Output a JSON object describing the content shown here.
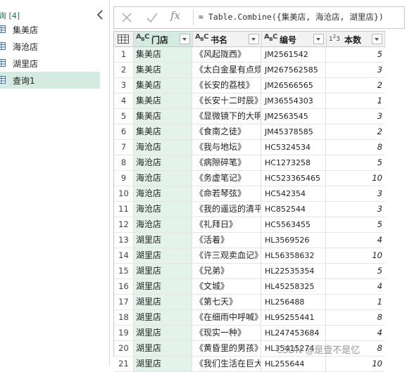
{
  "queries_pane": {
    "title": "询",
    "count": "[4]",
    "items": [
      {
        "label": "集美店"
      },
      {
        "label": "海沧店"
      },
      {
        "label": "湖里店"
      },
      {
        "label": "查询1"
      }
    ]
  },
  "formula_bar": {
    "fx": "fx",
    "formula": "= Table.Combine({集美店, 海沧店, 湖里店})"
  },
  "table": {
    "columns": [
      {
        "type": "ABC",
        "name": "门店"
      },
      {
        "type": "ABC",
        "name": "书名"
      },
      {
        "type": "ABC",
        "name": "编号"
      },
      {
        "type": "123",
        "name": "本数"
      }
    ],
    "rows": [
      {
        "n": "1",
        "store": "集美店",
        "title": "《风起陇西》",
        "code": "JM2561542",
        "qty": "5"
      },
      {
        "n": "2",
        "store": "集美店",
        "title": "《太白金星有点烦》",
        "code": "JM267562585",
        "qty": "3"
      },
      {
        "n": "3",
        "store": "集美店",
        "title": "《长安的荔枝》",
        "code": "JM26566565",
        "qty": "2"
      },
      {
        "n": "4",
        "store": "集美店",
        "title": "《长安十二时辰》",
        "code": "JM36554303",
        "qty": "1"
      },
      {
        "n": "5",
        "store": "集美店",
        "title": "《显微镜下的大明》",
        "code": "JM2563545",
        "qty": "3"
      },
      {
        "n": "6",
        "store": "集美店",
        "title": "《食南之徒》",
        "code": "JM45378585",
        "qty": "2"
      },
      {
        "n": "7",
        "store": "海沧店",
        "title": "《我与地坛》",
        "code": "HC5324534",
        "qty": "8"
      },
      {
        "n": "8",
        "store": "海沧店",
        "title": "《病隙碎笔》",
        "code": "HC1273258",
        "qty": "5"
      },
      {
        "n": "9",
        "store": "海沧店",
        "title": "《务虚笔记》",
        "code": "HC523365465",
        "qty": "10"
      },
      {
        "n": "10",
        "store": "海沧店",
        "title": "《命若琴弦》",
        "code": "HC542354",
        "qty": "3"
      },
      {
        "n": "11",
        "store": "海沧店",
        "title": "《我的遥远的清平湾》",
        "code": "HC852544",
        "qty": "3"
      },
      {
        "n": "12",
        "store": "海沧店",
        "title": "《礼拜日》",
        "code": "HC5563455",
        "qty": "5"
      },
      {
        "n": "13",
        "store": "湖里店",
        "title": "《活着》",
        "code": "HL3569526",
        "qty": "4"
      },
      {
        "n": "14",
        "store": "湖里店",
        "title": "《许三观卖血记》",
        "code": "HL56358632",
        "qty": "10"
      },
      {
        "n": "15",
        "store": "湖里店",
        "title": "《兄弟》",
        "code": "HL22535354",
        "qty": "5"
      },
      {
        "n": "16",
        "store": "湖里店",
        "title": "《文城》",
        "code": "HL45258325",
        "qty": "4"
      },
      {
        "n": "17",
        "store": "湖里店",
        "title": "《第七天》",
        "code": "HL256488",
        "qty": "1"
      },
      {
        "n": "18",
        "store": "湖里店",
        "title": "《在细雨中呼喊》",
        "code": "HL95255441",
        "qty": "8"
      },
      {
        "n": "19",
        "store": "湖里店",
        "title": "《现实一种》",
        "code": "HL247453684",
        "qty": "4"
      },
      {
        "n": "20",
        "store": "湖里店",
        "title": "《黄昏里的男孩》",
        "code": "HL35415274",
        "qty": "8"
      },
      {
        "n": "21",
        "store": "湖里店",
        "title": "《我们生活在巨大的差距里》",
        "code": "HL255644",
        "qty": "10"
      }
    ]
  },
  "watermark": "CSDN @是壹不是忆",
  "colors": {
    "accent": "#217346",
    "selected_query_bg": "#d3ebe0",
    "store_column_bg": "#e3f3ea"
  }
}
